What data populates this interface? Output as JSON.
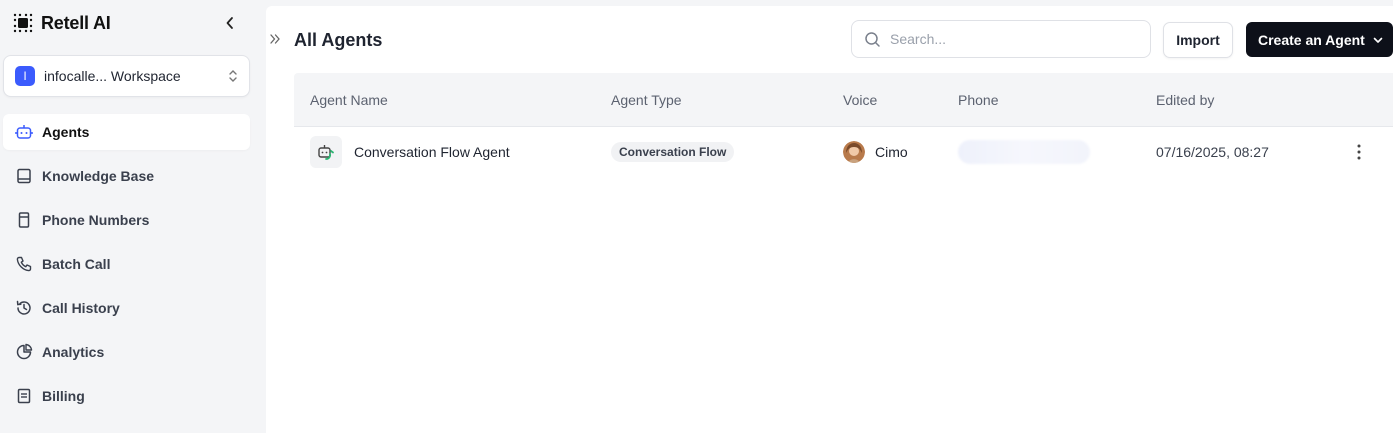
{
  "sidebar": {
    "brand": "Retell AI",
    "workspace": {
      "initial": "I",
      "name": "infocalle... Workspace"
    },
    "items": [
      {
        "label": "Agents",
        "icon": "bot-icon",
        "active": true
      },
      {
        "label": "Knowledge Base",
        "icon": "book-icon"
      },
      {
        "label": "Phone Numbers",
        "icon": "phone-device-icon"
      },
      {
        "label": "Batch Call",
        "icon": "phone-icon"
      },
      {
        "label": "Call History",
        "icon": "history-icon"
      },
      {
        "label": "Analytics",
        "icon": "pie-chart-icon"
      },
      {
        "label": "Billing",
        "icon": "receipt-icon"
      }
    ]
  },
  "header": {
    "title": "All Agents",
    "search_placeholder": "Search...",
    "import_label": "Import",
    "create_label": "Create an Agent"
  },
  "table": {
    "columns": [
      "Agent Name",
      "Agent Type",
      "Voice",
      "Phone",
      "Edited by"
    ],
    "rows": [
      {
        "name": "Conversation Flow Agent",
        "type": "Conversation Flow",
        "voice": "Cimo",
        "edited": "07/16/2025, 08:27"
      }
    ]
  },
  "colors": {
    "accent": "#3b5bfd",
    "primary_button": "#0d1019",
    "agent_icon_green": "#2bb673"
  }
}
